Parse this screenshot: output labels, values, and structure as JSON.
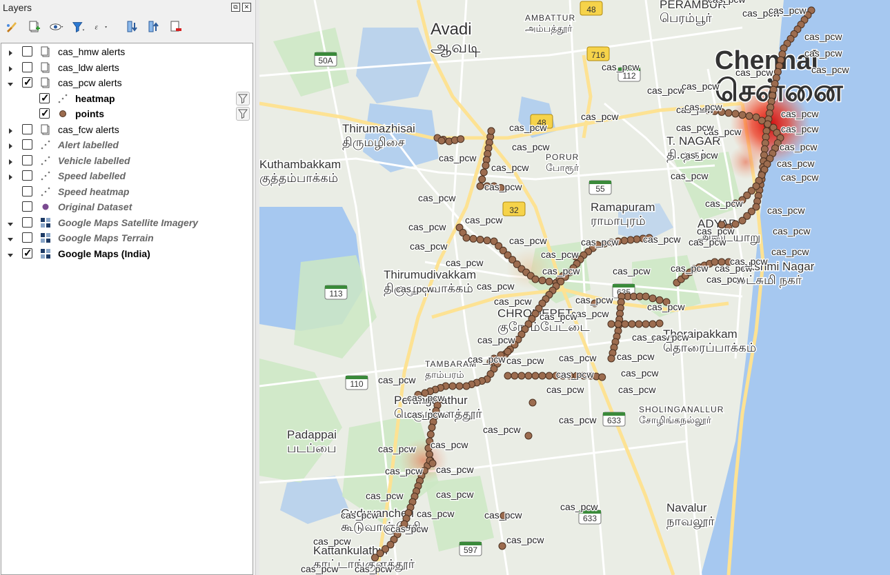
{
  "panel": {
    "title": "Layers",
    "float_glyph": "⧉",
    "close_glyph": "✕",
    "toolbar": [
      {
        "name": "style-manager-icon"
      },
      {
        "name": "add-group-icon"
      },
      {
        "name": "manage-map-themes-icon"
      },
      {
        "name": "filter-legend-icon"
      },
      {
        "name": "filter-by-expression-icon"
      },
      {
        "name": "expand-all-icon"
      },
      {
        "name": "collapse-all-icon"
      },
      {
        "name": "remove-layer-icon"
      }
    ]
  },
  "layers": [
    {
      "label": "cas_hmw alerts",
      "checked": false,
      "expand": "collapsed",
      "indent": 0,
      "icon": "group-icon",
      "style": "normal"
    },
    {
      "label": "cas_ldw alerts",
      "checked": false,
      "expand": "collapsed",
      "indent": 0,
      "icon": "group-icon",
      "style": "normal"
    },
    {
      "label": "cas_pcw alerts",
      "checked": true,
      "expand": "expanded",
      "indent": 0,
      "icon": "group-icon",
      "style": "normal"
    },
    {
      "label": "heatmap",
      "checked": true,
      "expand": "none",
      "indent": 1,
      "icon": "point-layer-icon",
      "style": "bold",
      "filter": true
    },
    {
      "label": "points",
      "checked": true,
      "expand": "none",
      "indent": 1,
      "icon": "brown-point-icon",
      "style": "bold",
      "filter": true
    },
    {
      "label": "cas_fcw alerts",
      "checked": false,
      "expand": "collapsed",
      "indent": 0,
      "icon": "group-icon",
      "style": "normal"
    },
    {
      "label": "Alert labelled",
      "checked": false,
      "expand": "collapsed",
      "indent": 0,
      "icon": "point-layer-icon",
      "style": "off"
    },
    {
      "label": "Vehicle labelled",
      "checked": false,
      "expand": "collapsed",
      "indent": 0,
      "icon": "point-layer-icon",
      "style": "off"
    },
    {
      "label": "Speed labelled",
      "checked": false,
      "expand": "collapsed",
      "indent": 0,
      "icon": "point-layer-icon",
      "style": "off"
    },
    {
      "label": "Speed heatmap",
      "checked": false,
      "expand": "none",
      "indent": 0,
      "icon": "point-layer-icon",
      "style": "off"
    },
    {
      "label": "Original Dataset",
      "checked": false,
      "expand": "none",
      "indent": 0,
      "icon": "purple-point-icon",
      "style": "off"
    },
    {
      "label": "Google Maps Satellite Imagery",
      "checked": false,
      "expand": "expanded",
      "indent": 0,
      "icon": "raster-layer-icon",
      "style": "off"
    },
    {
      "label": "Google Maps Terrain",
      "checked": false,
      "expand": "expanded",
      "indent": 0,
      "icon": "raster-layer-icon",
      "style": "off"
    },
    {
      "label": "Google Maps (India)",
      "checked": true,
      "expand": "expanded",
      "indent": 0,
      "icon": "raster-layer-icon",
      "style": "bold"
    }
  ],
  "map": {
    "land": "#eaede5",
    "water": "#a6c8f0",
    "park": "#cde8c4",
    "road": "#ffffff",
    "highway": "#fde293",
    "point_fill": "#9c6c4f",
    "point_stroke": "#4a3020",
    "places": [
      {
        "en": "Avadi",
        "ta": "ஆவடி",
        "size": "big"
      },
      {
        "en": "Chennai",
        "ta": "சென்னை",
        "size": "huge"
      },
      {
        "en": "AMBATTUR",
        "ta": "அம்பத்தூர்",
        "size": "small"
      },
      {
        "en": "PERAMBUR",
        "ta": "பெரம்பூர்",
        "size": "mid"
      },
      {
        "en": "Thirumazhisai",
        "ta": "திருமழிசை",
        "size": "mid"
      },
      {
        "en": "Kuthambakkam",
        "ta": "குத்தம்பாக்கம்",
        "size": "mid"
      },
      {
        "en": "PORUR",
        "ta": "போரூர்",
        "size": "small"
      },
      {
        "en": "T. NAGAR",
        "ta": "தி. நகர்",
        "size": "mid"
      },
      {
        "en": "Ramapuram",
        "ta": "ராமாபுரம்",
        "size": "mid"
      },
      {
        "en": "ADYAR",
        "ta": "அடையாறு",
        "size": "mid"
      },
      {
        "en": "Thirumudivakkam",
        "ta": "திருமுடிவாக்கம்",
        "size": "mid"
      },
      {
        "en": "Lakshmi Nagar",
        "ta": "லட்சுமி நகர்",
        "size": "mid"
      },
      {
        "en": "CHROMEPET",
        "ta": "குரோம்பேட்டை",
        "size": "mid"
      },
      {
        "en": "Thoraipakkam",
        "ta": "தொரைப்பாக்கம்",
        "size": "mid"
      },
      {
        "en": "TAMBARAM",
        "ta": "தாம்பரம்",
        "size": "small"
      },
      {
        "en": "Perungalathur",
        "ta": "பெருங்களத்தூர்",
        "size": "mid"
      },
      {
        "en": "SHOLINGANALLUR",
        "ta": "சோழிங்கநல்லூர்",
        "size": "small"
      },
      {
        "en": "Padappai",
        "ta": "படப்பை",
        "size": "mid"
      },
      {
        "en": "Guduvancheri",
        "ta": "கூடுவாஞ்சேரி",
        "size": "mid"
      },
      {
        "en": "Navalur",
        "ta": "நாவலூர்",
        "size": "mid"
      },
      {
        "en": "Kattankulathur",
        "ta": "காட்டாங்குளத்தூர்",
        "size": "mid"
      }
    ],
    "shields": [
      "48",
      "716",
      "50A",
      "112",
      "48",
      "55",
      "32",
      "113",
      "635",
      "110",
      "633",
      "633",
      "597"
    ],
    "point_label": "cas_pcw"
  }
}
